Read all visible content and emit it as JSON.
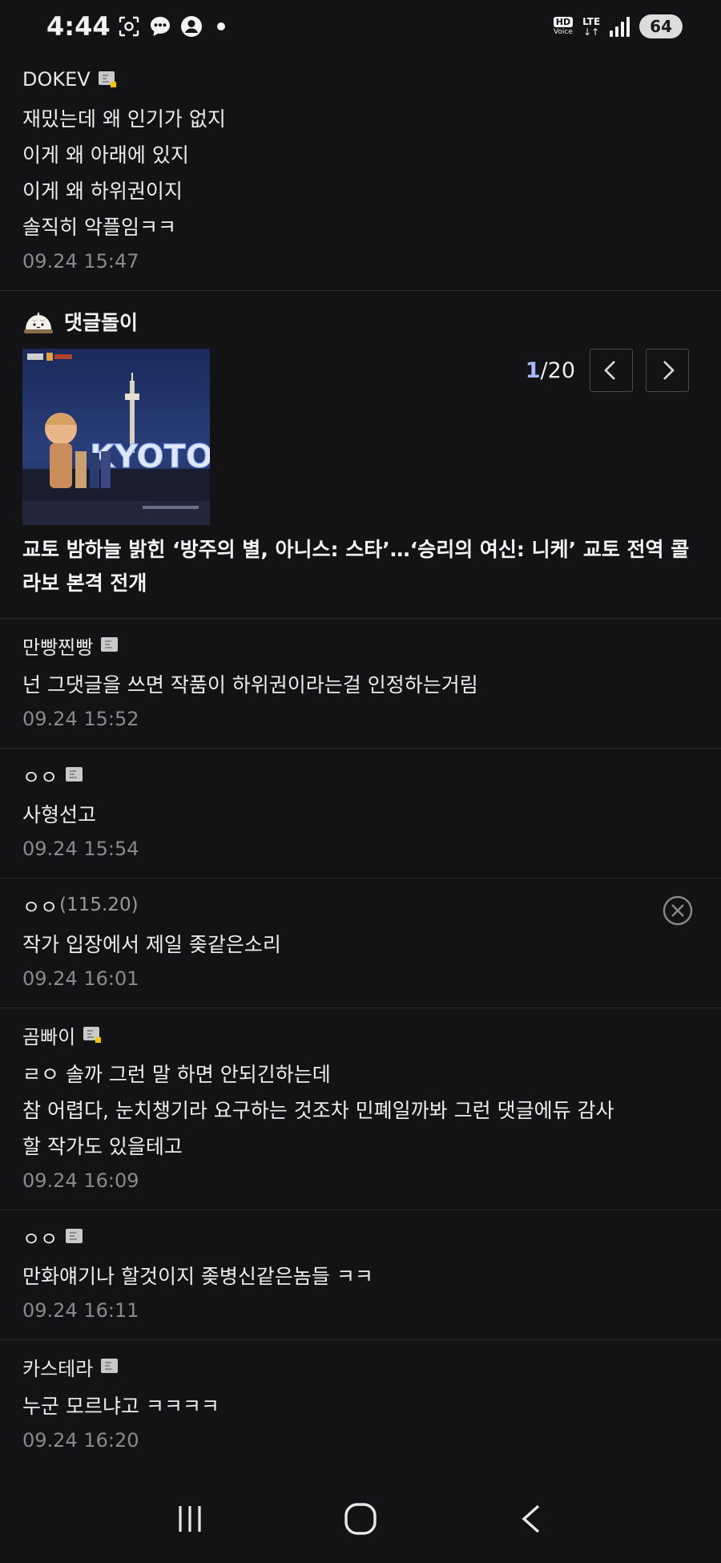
{
  "status_bar": {
    "time": "4:44",
    "icons": [
      "screenshot-icon",
      "chat-bubble-icon",
      "account-icon",
      "notification-dot-icon"
    ],
    "hd_label": "HD",
    "voice_label": "Voice",
    "network": "LTE",
    "network_arrows": "↓↑",
    "battery": "64"
  },
  "comments_top": [
    {
      "author": "DOKEV",
      "badge": "level-badge",
      "lines": [
        "재밌는데 왜 인기가 없지",
        "이게 왜 아래에 있지",
        "이게 왜 하위권이지",
        "솔직히 악플임ㅋㅋ"
      ],
      "time": "09.24 15:47"
    }
  ],
  "bot_card": {
    "name": "댓글돌이",
    "avatar_icon": "dumpling-avatar-icon",
    "thumbnail_alt": "KYOTO night sign photo",
    "thumbnail_sign_text": "KYOTO",
    "pager_current": "1",
    "pager_total": "/20",
    "prev_icon": "chevron-left-icon",
    "next_icon": "chevron-right-icon",
    "headline": "교토 밤하늘 밝힌 ‘방주의 별, 아니스: 스타’…‘승리의 여신: 니케’ 교토 전역 콜라보 본격 전개"
  },
  "comments_bottom": [
    {
      "author": "만빵찐빵",
      "ip": "",
      "badge": "member-badge",
      "lines": [
        "넌 그댓글을 쓰면 작품이 하위권이라는걸 인정하는거림"
      ],
      "time": "09.24 15:52",
      "deletable": false
    },
    {
      "author": "ㅇㅇ",
      "ip": "",
      "badge": "member-badge",
      "lines": [
        "사형선고"
      ],
      "time": "09.24 15:54",
      "deletable": false
    },
    {
      "author": "ㅇㅇ",
      "ip": "(115.20)",
      "badge": "",
      "lines": [
        "작가 입장에서 제일 좆같은소리"
      ],
      "time": "09.24 16:01",
      "deletable": true
    },
    {
      "author": "곰빠이",
      "ip": "",
      "badge": "level-badge",
      "lines": [
        "ㄹㅇ 솔까 그런 말 하면 안되긴하는데",
        "참 어렵다, 눈치챙기라 요구하는 것조차 민폐일까봐 그런 댓글에듀 감사",
        "할 작가도 있을테고"
      ],
      "time": "09.24 16:09",
      "deletable": false
    },
    {
      "author": "ㅇㅇ",
      "ip": "",
      "badge": "member-badge",
      "lines": [
        "만화얘기나 할것이지 좆병신같은놈들 ㅋㅋ"
      ],
      "time": "09.24 16:11",
      "deletable": false
    },
    {
      "author": "카스테라",
      "ip": "",
      "badge": "member-badge",
      "lines": [
        "누군 모르냐고 ㅋㅋㅋㅋ"
      ],
      "time": "09.24 16:20",
      "deletable": false
    }
  ],
  "nav_bar": {
    "recent_icon": "recent-apps-icon",
    "home_icon": "home-icon",
    "back_icon": "back-icon"
  },
  "colors": {
    "background": "#131315",
    "divider": "#2c2c30",
    "pager_accent": "#a7b7ff",
    "meta_text": "#8a8a8e"
  }
}
